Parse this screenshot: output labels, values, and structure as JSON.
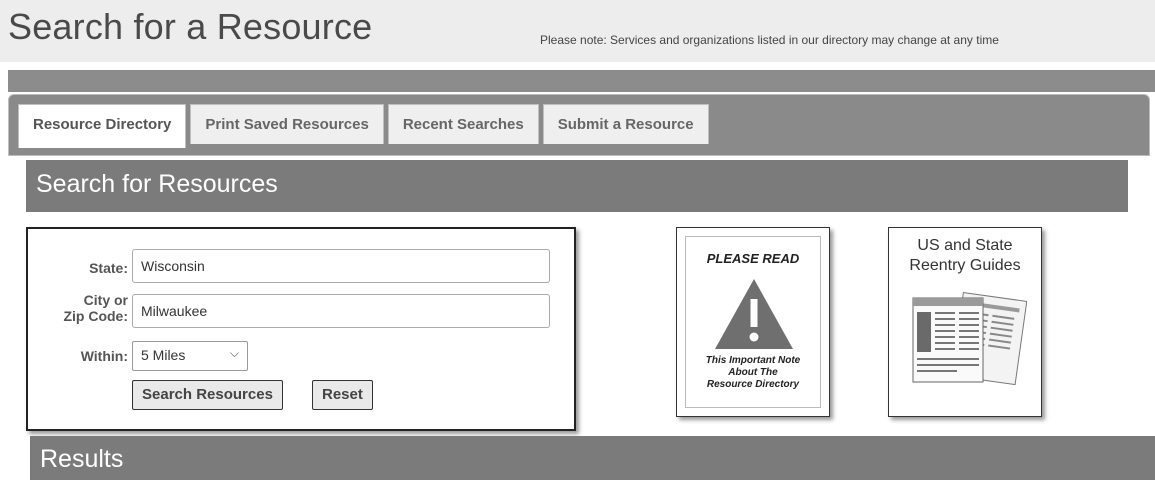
{
  "header": {
    "title": "Search for a Resource",
    "note": "Please note: Services and organizations listed in our directory may change at any time"
  },
  "tabs": [
    {
      "label": "Resource Directory",
      "active": true
    },
    {
      "label": "Print Saved Resources",
      "active": false
    },
    {
      "label": "Recent Searches",
      "active": false
    },
    {
      "label": "Submit a Resource",
      "active": false
    }
  ],
  "search_section": {
    "title": "Search for Resources"
  },
  "form": {
    "state_label": "State:",
    "state_value": "Wisconsin",
    "city_label_line1": "City or",
    "city_label_line2": "Zip Code:",
    "city_value": "Milwaukee",
    "within_label": "Within:",
    "within_value": "5 Miles",
    "search_button": "Search Resources",
    "reset_button": "Reset"
  },
  "please_read_card": {
    "heading": "PLEASE READ",
    "body_line1": "This Important Note",
    "body_line2": "About The",
    "body_line3": "Resource Directory",
    "icon": "warning-triangle-icon"
  },
  "guides_card": {
    "title_line1": "US and State",
    "title_line2": "Reentry Guides",
    "icon": "guide-documents-icon"
  },
  "results_section": {
    "title": "Results"
  },
  "colors": {
    "header_bg": "#ededed",
    "bar_dark": "#7b7b7b",
    "tab_bg": "#efefef"
  }
}
